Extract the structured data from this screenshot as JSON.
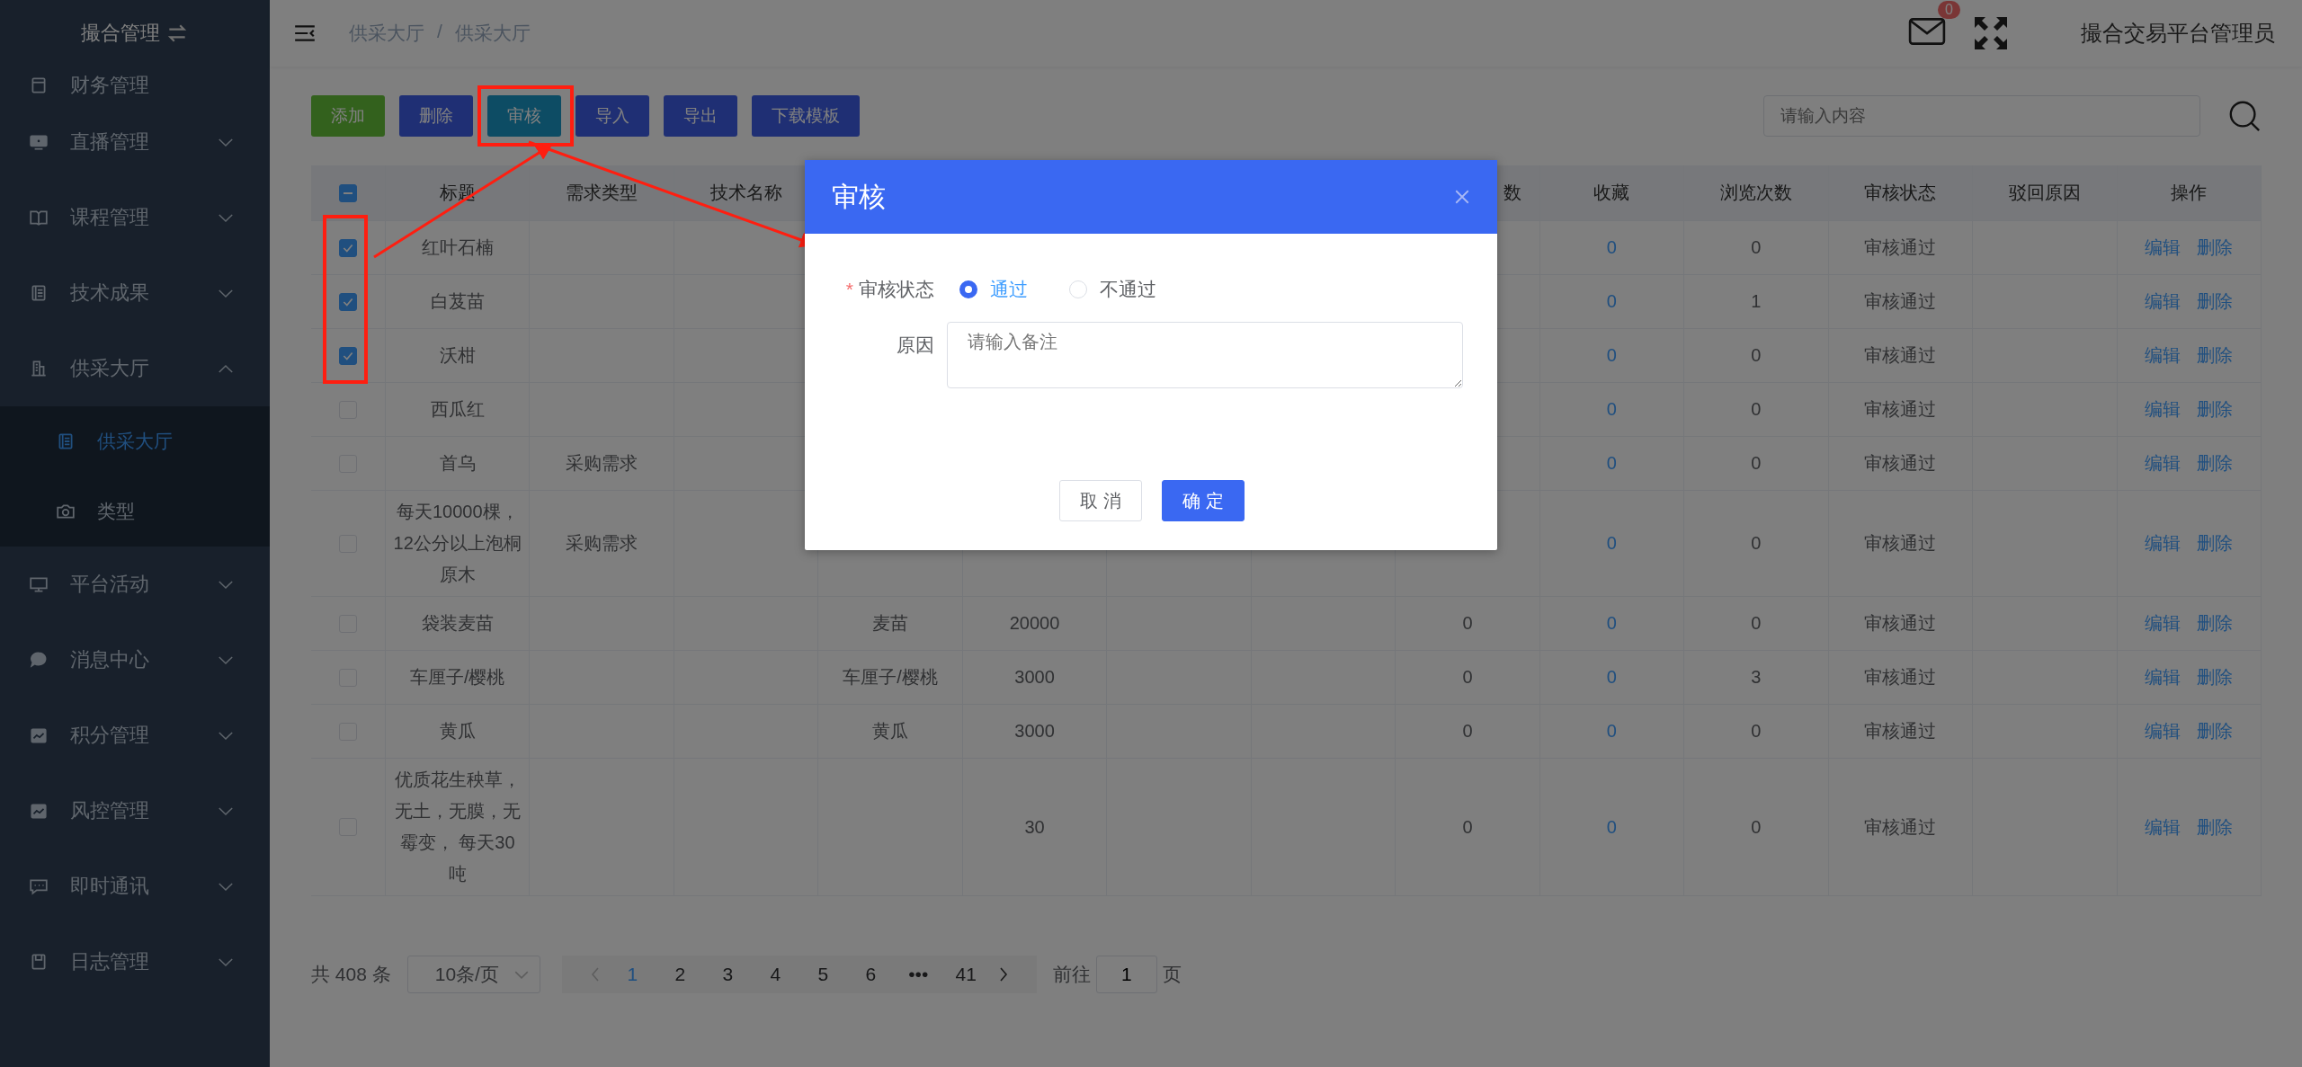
{
  "sidebar": {
    "title": "撮合管理",
    "items": [
      {
        "label": "财务管理"
      },
      {
        "label": "直播管理",
        "expanded": false
      },
      {
        "label": "课程管理",
        "expanded": false
      },
      {
        "label": "技术成果",
        "expanded": false
      },
      {
        "label": "供采大厅",
        "expanded": true,
        "children": [
          {
            "label": "供采大厅",
            "selected": true
          },
          {
            "label": "类型",
            "selected": false
          }
        ]
      },
      {
        "label": "平台活动",
        "expanded": false
      },
      {
        "label": "消息中心",
        "expanded": false
      },
      {
        "label": "积分管理",
        "expanded": false
      },
      {
        "label": "风控管理",
        "expanded": false
      },
      {
        "label": "即时通讯",
        "expanded": false
      },
      {
        "label": "日志管理",
        "expanded": false
      }
    ]
  },
  "topbar": {
    "breadcrumb": [
      "供采大厅",
      "供采大厅"
    ],
    "breadcrumb_separator": "/",
    "message_count": "0",
    "user": "撮合交易平台管理员"
  },
  "toolbar": {
    "buttons": [
      {
        "label": "添加",
        "kind": "success"
      },
      {
        "label": "删除",
        "kind": "primary"
      },
      {
        "label": "审核",
        "kind": "info"
      },
      {
        "label": "导入",
        "kind": "primary"
      },
      {
        "label": "导出",
        "kind": "primary"
      },
      {
        "label": "下载模板",
        "kind": "primary"
      }
    ],
    "search": {
      "placeholder": "请输入内容"
    }
  },
  "table": {
    "select_all": {
      "indeterminate": true
    },
    "columns": [
      {
        "label": "标题"
      },
      {
        "label": "需求类型"
      },
      {
        "label": "技术名称"
      },
      {},
      {},
      {},
      {},
      {
        "label": "数"
      },
      {
        "label": "收藏"
      },
      {
        "label": "浏览次数"
      },
      {
        "label": "审核状态"
      },
      {
        "label": "驳回原因"
      },
      {
        "label": "操作"
      }
    ],
    "rows": [
      {
        "checked": true,
        "title": "红叶石楠",
        "favorites": "0",
        "views": "0",
        "status": "审核通过",
        "actions": [
          "编辑",
          "删除"
        ]
      },
      {
        "checked": true,
        "title": "白芨苗",
        "favorites": "0",
        "views": "1",
        "status": "审核通过",
        "actions": [
          "编辑",
          "删除"
        ]
      },
      {
        "checked": true,
        "title": "沃柑",
        "favorites": "0",
        "views": "0",
        "status": "审核通过",
        "actions": [
          "编辑",
          "删除"
        ]
      },
      {
        "checked": false,
        "title": "西瓜红",
        "favorites": "0",
        "views": "0",
        "status": "审核通过",
        "actions": [
          "编辑",
          "删除"
        ]
      },
      {
        "checked": false,
        "title": "首乌",
        "demand_type": "采购需求",
        "favorites": "0",
        "views": "0",
        "status": "审核通过",
        "actions": [
          "编辑",
          "删除"
        ]
      },
      {
        "checked": false,
        "title": "每天10000棵，12公分以上泡桐原木",
        "demand_type": "采购需求",
        "favorites": "0",
        "views": "0",
        "status": "审核通过",
        "actions": [
          "编辑",
          "删除"
        ]
      },
      {
        "checked": false,
        "title": "袋装麦苗",
        "column_5": "麦苗",
        "column_6": "20000",
        "column_9": "0",
        "favorites": "0",
        "views": "0",
        "status": "审核通过",
        "actions": [
          "编辑",
          "删除"
        ]
      },
      {
        "checked": false,
        "title": "车厘子/樱桃",
        "column_5": "车厘子/樱桃",
        "column_6": "3000",
        "column_9": "0",
        "favorites": "0",
        "views": "3",
        "status": "审核通过",
        "actions": [
          "编辑",
          "删除"
        ]
      },
      {
        "checked": false,
        "title": "黄瓜",
        "column_5": "黄瓜",
        "column_6": "3000",
        "column_9": "0",
        "favorites": "0",
        "views": "0",
        "status": "审核通过",
        "actions": [
          "编辑",
          "删除"
        ]
      },
      {
        "checked": false,
        "title": "优质花生秧草，无土，无膜，无霉变， 每天30吨",
        "column_6": "30",
        "column_9": "0",
        "favorites": "0",
        "views": "0",
        "status": "审核通过",
        "actions": [
          "编辑",
          "删除"
        ]
      }
    ]
  },
  "pagination": {
    "total": "共 408 条",
    "page_size": "10条/页",
    "pages": [
      {
        "label": "1",
        "selected": true
      },
      {
        "label": "2",
        "selected": false
      },
      {
        "label": "3",
        "selected": false
      },
      {
        "label": "4",
        "selected": false
      },
      {
        "label": "5",
        "selected": false
      },
      {
        "label": "6",
        "selected": false
      },
      {
        "label": "•••",
        "selected": false
      },
      {
        "label": "41",
        "selected": false
      }
    ],
    "goto_label": "前往",
    "goto_value": "1",
    "goto_suffix": "页"
  },
  "dialog": {
    "title": "审核",
    "fields": [
      {
        "kind": "radio",
        "label": "审核状态",
        "required_mark": "*",
        "options": [
          {
            "label": "通过",
            "selected": true
          },
          {
            "label": "不通过",
            "selected": false
          }
        ]
      },
      {
        "kind": "textarea",
        "label": "原因",
        "placeholder": "请输入备注"
      }
    ],
    "buttons": [
      {
        "label": "取 消",
        "kind": "default"
      },
      {
        "label": "确 定",
        "kind": "primary"
      }
    ]
  }
}
